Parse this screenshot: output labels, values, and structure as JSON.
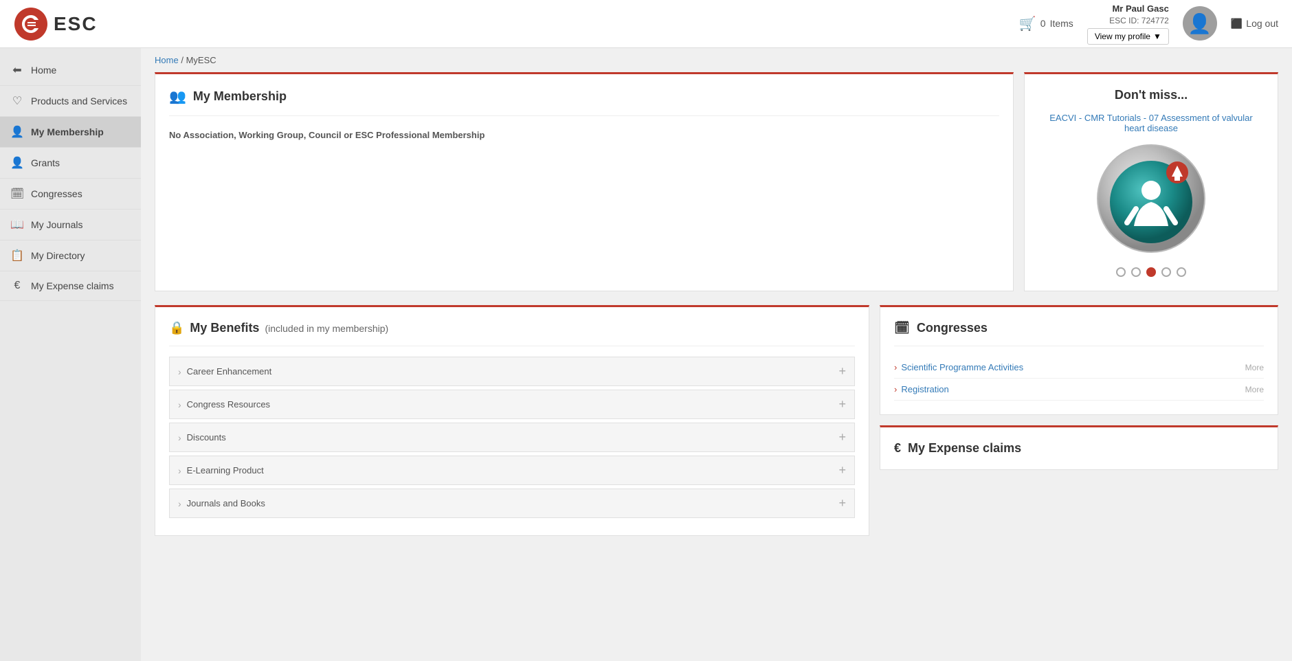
{
  "header": {
    "logo_text": "ESC",
    "cart_count": "0",
    "cart_label": "Items",
    "user_name": "Mr Paul Gasc",
    "user_id": "ESC ID: 724772",
    "view_profile_label": "View my profile",
    "logout_label": "Log out"
  },
  "breadcrumb": {
    "home_label": "Home",
    "separator": "/",
    "current": "MyESC"
  },
  "sidebar": {
    "items": [
      {
        "id": "home",
        "label": "Home",
        "icon": "⬅"
      },
      {
        "id": "products",
        "label": "Products and Services",
        "icon": "♡"
      },
      {
        "id": "membership",
        "label": "My Membership",
        "icon": "👤"
      },
      {
        "id": "grants",
        "label": "Grants",
        "icon": "👤"
      },
      {
        "id": "congresses",
        "label": "Congresses",
        "icon": "🗓"
      },
      {
        "id": "journals",
        "label": "My Journals",
        "icon": "📖"
      },
      {
        "id": "directory",
        "label": "My Directory",
        "icon": "📋"
      },
      {
        "id": "expense",
        "label": "My Expense claims",
        "icon": "€"
      }
    ]
  },
  "membership_section": {
    "title": "My Membership",
    "message": "No Association, Working Group, Council or ESC Professional Membership"
  },
  "dont_miss": {
    "title": "Don't miss...",
    "link_text": "EACVI - CMR Tutorials - 07 Assessment of valvular heart disease",
    "dots": [
      {
        "active": false
      },
      {
        "active": false
      },
      {
        "active": true
      },
      {
        "active": false
      },
      {
        "active": false
      }
    ]
  },
  "benefits": {
    "title": "My Benefits",
    "subtitle": "(included in my membership)",
    "items": [
      {
        "label": "Career Enhancement"
      },
      {
        "label": "Congress Resources"
      },
      {
        "label": "Discounts"
      },
      {
        "label": "E-Learning Product"
      },
      {
        "label": "Journals and Books"
      }
    ]
  },
  "congresses": {
    "title": "Congresses",
    "items": [
      {
        "label": "Scientific Programme Activities",
        "more": "More"
      },
      {
        "label": "Registration",
        "more": "More"
      }
    ]
  },
  "expense_claims": {
    "title": "My Expense claims"
  }
}
